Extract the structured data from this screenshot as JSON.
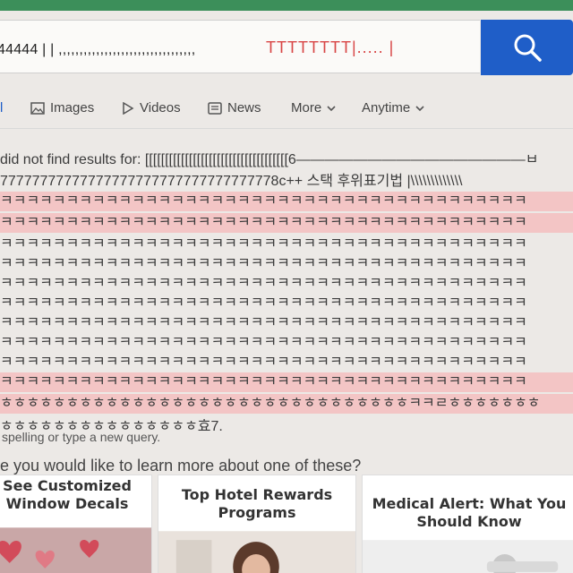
{
  "search": {
    "query_left": "44444 | | ,,,,,,,,,,,,,,,,,,,,,,,,,,,,,,,,,",
    "query_right": "TTTTTTTT|..... |"
  },
  "tabs": {
    "all_label": "l",
    "images_label": "Images",
    "videos_label": "Videos",
    "news_label": "News",
    "more_label": "More",
    "anytime_label": "Anytime"
  },
  "results": {
    "lines": [
      "did not find results for: [[[[[[[[[[[[[[[[[[[[[[[[[[[[[[[[[[[[6————————————————ㅂ",
      "77777777777777777777777777777777778c++ 스택 후위표기법 |\\\\\\\\\\\\\\\\\\\\\\\\\\",
      "ㅋㅋㅋㅋㅋㅋㅋㅋㅋㅋㅋㅋㅋㅋㅋㅋㅋㅋㅋㅋㅋㅋㅋㅋㅋㅋㅋㅋㅋㅋㅋㅋㅋㅋㅋㅋㅋㅋㅋㅋ",
      "ㅋㅋㅋㅋㅋㅋㅋㅋㅋㅋㅋㅋㅋㅋㅋㅋㅋㅋㅋㅋㅋㅋㅋㅋㅋㅋㅋㅋㅋㅋㅋㅋㅋㅋㅋㅋㅋㅋㅋㅋ",
      "ㅋㅋㅋㅋㅋㅋㅋㅋㅋㅋㅋㅋㅋㅋㅋㅋㅋㅋㅋㅋㅋㅋㅋㅋㅋㅋㅋㅋㅋㅋㅋㅋㅋㅋㅋㅋㅋㅋㅋㅋ",
      "ㅋㅋㅋㅋㅋㅋㅋㅋㅋㅋㅋㅋㅋㅋㅋㅋㅋㅋㅋㅋㅋㅋㅋㅋㅋㅋㅋㅋㅋㅋㅋㅋㅋㅋㅋㅋㅋㅋㅋㅋ",
      "ㅋㅋㅋㅋㅋㅋㅋㅋㅋㅋㅋㅋㅋㅋㅋㅋㅋㅋㅋㅋㅋㅋㅋㅋㅋㅋㅋㅋㅋㅋㅋㅋㅋㅋㅋㅋㅋㅋㅋㅋ",
      "ㅋㅋㅋㅋㅋㅋㅋㅋㅋㅋㅋㅋㅋㅋㅋㅋㅋㅋㅋㅋㅋㅋㅋㅋㅋㅋㅋㅋㅋㅋㅋㅋㅋㅋㅋㅋㅋㅋㅋㅋ",
      "ㅋㅋㅋㅋㅋㅋㅋㅋㅋㅋㅋㅋㅋㅋㅋㅋㅋㅋㅋㅋㅋㅋㅋㅋㅋㅋㅋㅋㅋㅋㅋㅋㅋㅋㅋㅋㅋㅋㅋㅋ",
      "ㅋㅋㅋㅋㅋㅋㅋㅋㅋㅋㅋㅋㅋㅋㅋㅋㅋㅋㅋㅋㅋㅋㅋㅋㅋㅋㅋㅋㅋㅋㅋㅋㅋㅋㅋㅋㅋㅋㅋㅋ",
      "ㅋㅋㅋㅋㅋㅋㅋㅋㅋㅋㅋㅋㅋㅋㅋㅋㅋㅋㅋㅋㅋㅋㅋㅋㅋㅋㅋㅋㅋㅋㅋㅋㅋㅋㅋㅋㅋㅋㅋㅋ",
      "ㅋㅋㅋㅋㅋㅋㅋㅋㅋㅋㅋㅋㅋㅋㅋㅋㅋㅋㅋㅋㅋㅋㅋㅋㅋㅋㅋㅋㅋㅋㅋㅋㅋㅋㅋㅋㅋㅋㅋㅋ",
      "ㅎㅎㅎㅎㅎㅎㅎㅎㅎㅎㅎㅎㅎㅎㅎㅎㅎㅎㅎㅎㅎㅎㅎㅎㅎㅎㅎㅎㅎㅎㅎㅋㅋㄹㅎㅎㅎㅎㅎㅎㅎ",
      "ㅎㅎㅎㅎㅎㅎㅎㅎㅎㅎㅎㅎㅎㅎㅎ효7."
    ],
    "spelling_msg": "spelling or type a new query.",
    "learn_more": "e you would like to learn more about one of these?"
  },
  "cards": [
    {
      "title": "See Customized Window Decals"
    },
    {
      "title": "Top Hotel Rewards Programs"
    },
    {
      "title": "Medical Alert: What You Should Know"
    }
  ],
  "colors": {
    "search_button": "#1f5ec8",
    "highlight": "#f3c5c5",
    "top_bar": "#3c8f5a"
  }
}
